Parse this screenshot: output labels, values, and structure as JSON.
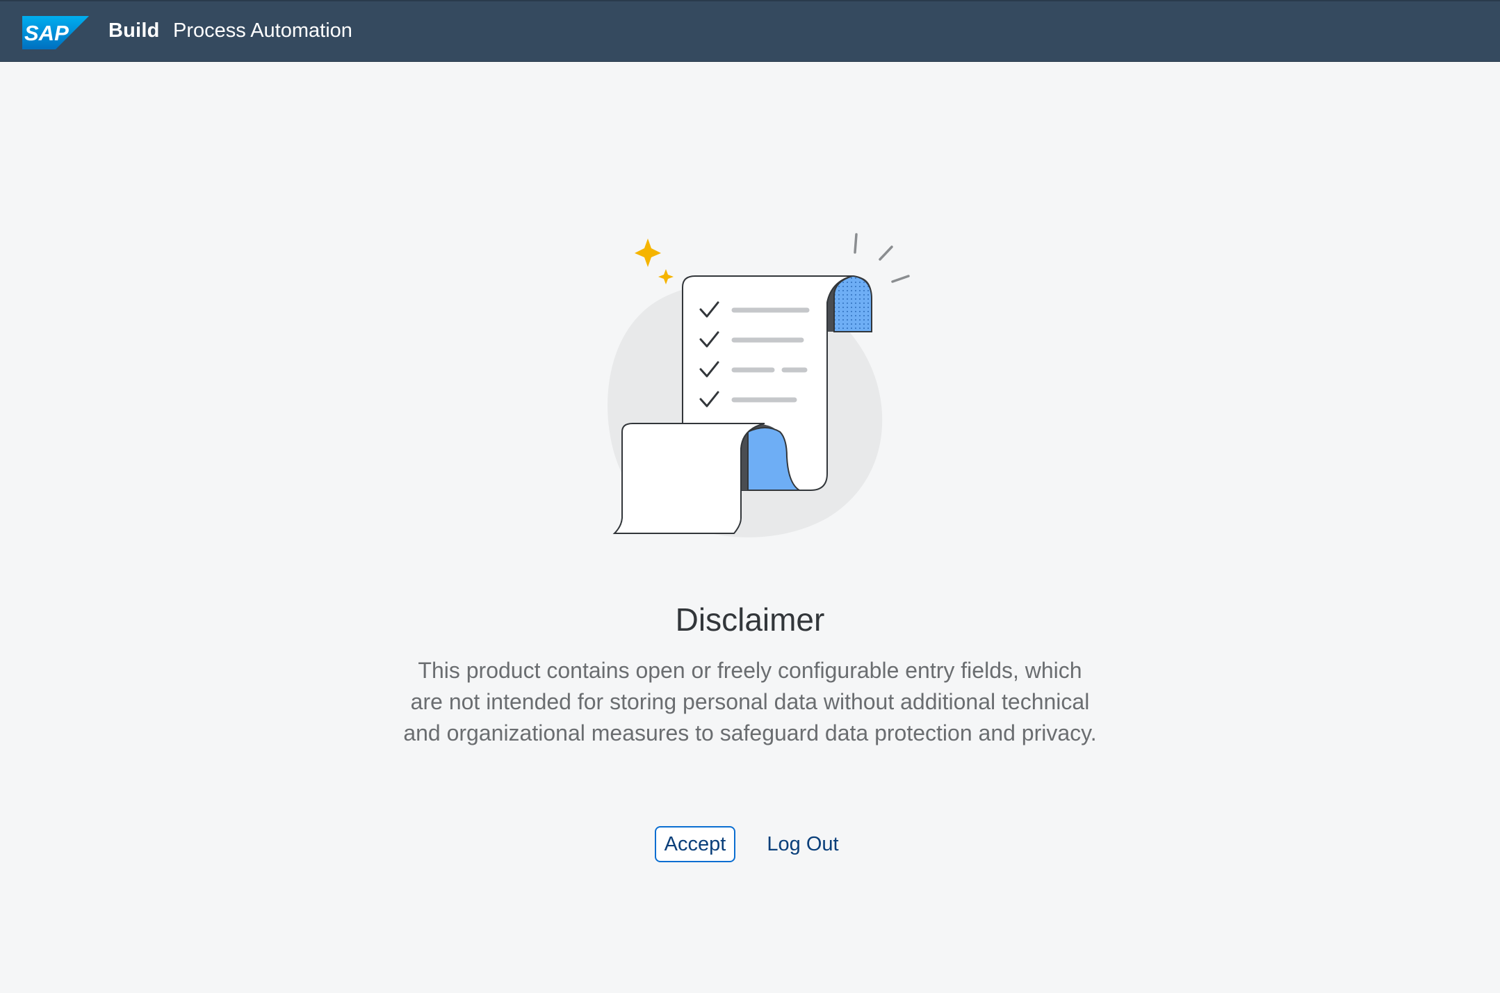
{
  "shellbar": {
    "logo_text": "SAP",
    "brand_bold": "Build",
    "brand_product": "Process Automation"
  },
  "illustration": {
    "icon": "document-scroll-checklist-icon"
  },
  "disclaimer": {
    "title": "Disclaimer",
    "message": "This product contains open or freely configurable entry fields, which are not intended for storing personal data without additional technical and organizational measures to safeguard data protection and privacy."
  },
  "actions": {
    "accept_label": "Accept",
    "logout_label": "Log Out"
  },
  "colors": {
    "shellbar": "#354a5f",
    "background": "#f5f6f7",
    "accent": "#0a6ed1",
    "scroll_blue": "#6eaef5",
    "sparkle": "#f5b400"
  }
}
